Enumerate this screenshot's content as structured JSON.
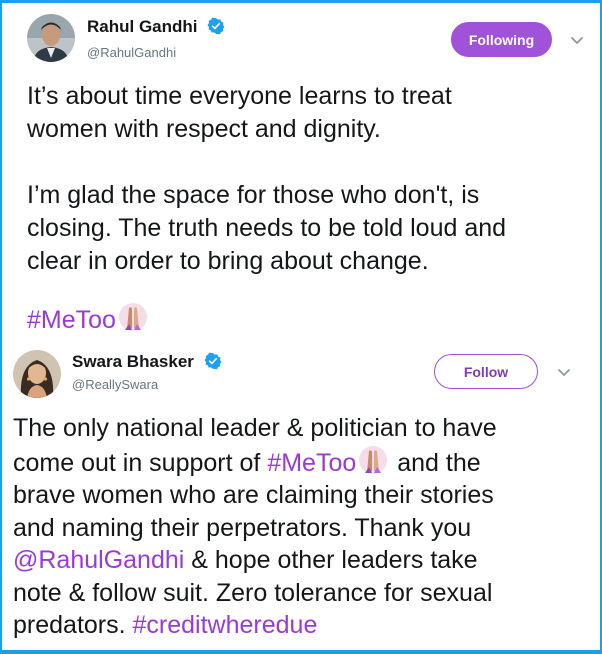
{
  "tweet1": {
    "name": "Rahul Gandhi",
    "handle": "@RahulGandhi",
    "button_label": "Following",
    "text_line1": "It’s about time everyone learns to treat",
    "text_line2": "women with respect and dignity.",
    "text_line3": "I’m glad the space for those who don't, is",
    "text_line4": "closing. The truth needs to be told loud and",
    "text_line5": "clear in order to bring about change.",
    "hashtag": "#MeToo"
  },
  "tweet2": {
    "name": "Swara Bhasker",
    "handle": "@ReallySwara",
    "button_label": "Follow",
    "line1": "The only national leader & politician to have",
    "line2_prefix": "come out in support of ",
    "line2_hashtag": "#MeToo",
    "line2_suffix": " and the",
    "line3": "brave women who are claiming their stories",
    "line4": "and naming their perpetrators. Thank you",
    "line5_mention": "@RahulGandhi",
    "line5_suffix": " & hope other leaders take",
    "line6": "note & follow suit. Zero tolerance for sexual",
    "line7_prefix": "predators. ",
    "line7_hashtag": "#creditwheredue"
  },
  "colors": {
    "frame": "#1aa0e8",
    "accent_purple": "#9b39d6",
    "verified_blue": "#1da1f2"
  },
  "icons": {
    "verified": "verified-badge-icon",
    "chevron": "chevron-down-icon",
    "hashflag": "raised-hands-hashflag-icon"
  }
}
